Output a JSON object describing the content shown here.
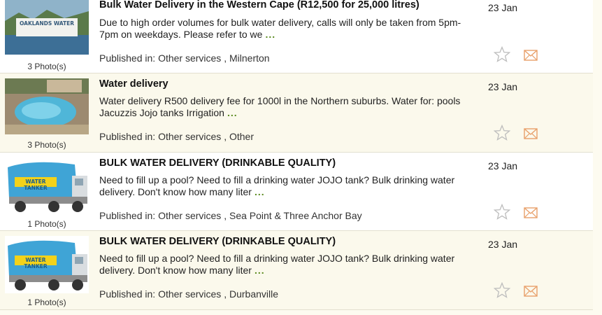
{
  "listings": [
    {
      "title": "Bulk Water Delivery in the Western Cape (R12,500 for 25,000 litres)",
      "description": "Due to high order volumes for bulk water delivery, calls will only be taken from 5pm-7pm on weekdays. Please refer to we",
      "more": "...",
      "published_prefix": "Published in: ",
      "category": "Other services",
      "separator": " , ",
      "location": "Milnerton",
      "date": "23 Jan",
      "photos": "3 Photo(s)",
      "thumb_text": "OAKLANDS WATER"
    },
    {
      "title": "Water delivery",
      "description": "Water delivery R500 delivery fee for 1000l in the Northern suburbs. Water for: pools Jacuzzis Jojo tanks Irrigation",
      "more": "...",
      "published_prefix": "Published in: ",
      "category": "Other services",
      "separator": " , ",
      "location": "Other",
      "date": "23 Jan",
      "photos": "3 Photo(s)"
    },
    {
      "title": "BULK WATER DELIVERY (DRINKABLE QUALITY)",
      "description": "Need to fill up a pool? Need to fill a drinking water JOJO tank? Bulk drinking water delivery. Don't know how many liter",
      "more": "...",
      "published_prefix": "Published in: ",
      "category": "Other services",
      "separator": " , ",
      "location": "Sea Point & Three Anchor Bay",
      "date": "23 Jan",
      "photos": "1 Photo(s)",
      "thumb_text": "WATER TANKER"
    },
    {
      "title": "BULK WATER DELIVERY (DRINKABLE QUALITY)",
      "description": "Need to fill up a pool? Need to fill a drinking water JOJO tank? Bulk drinking water delivery. Don't know how many liter",
      "more": "...",
      "published_prefix": "Published in: ",
      "category": "Other services",
      "separator": " , ",
      "location": "Durbanville",
      "date": "23 Jan",
      "photos": "1 Photo(s)",
      "thumb_text": "WATER TANKER"
    }
  ],
  "icons": {
    "favorite": "star-outline-icon",
    "contact": "envelope-icon"
  },
  "colors": {
    "more_link": "#5a8a1e",
    "icon_outline": "#e8b98a",
    "row_alt": "#fbf9ec"
  }
}
